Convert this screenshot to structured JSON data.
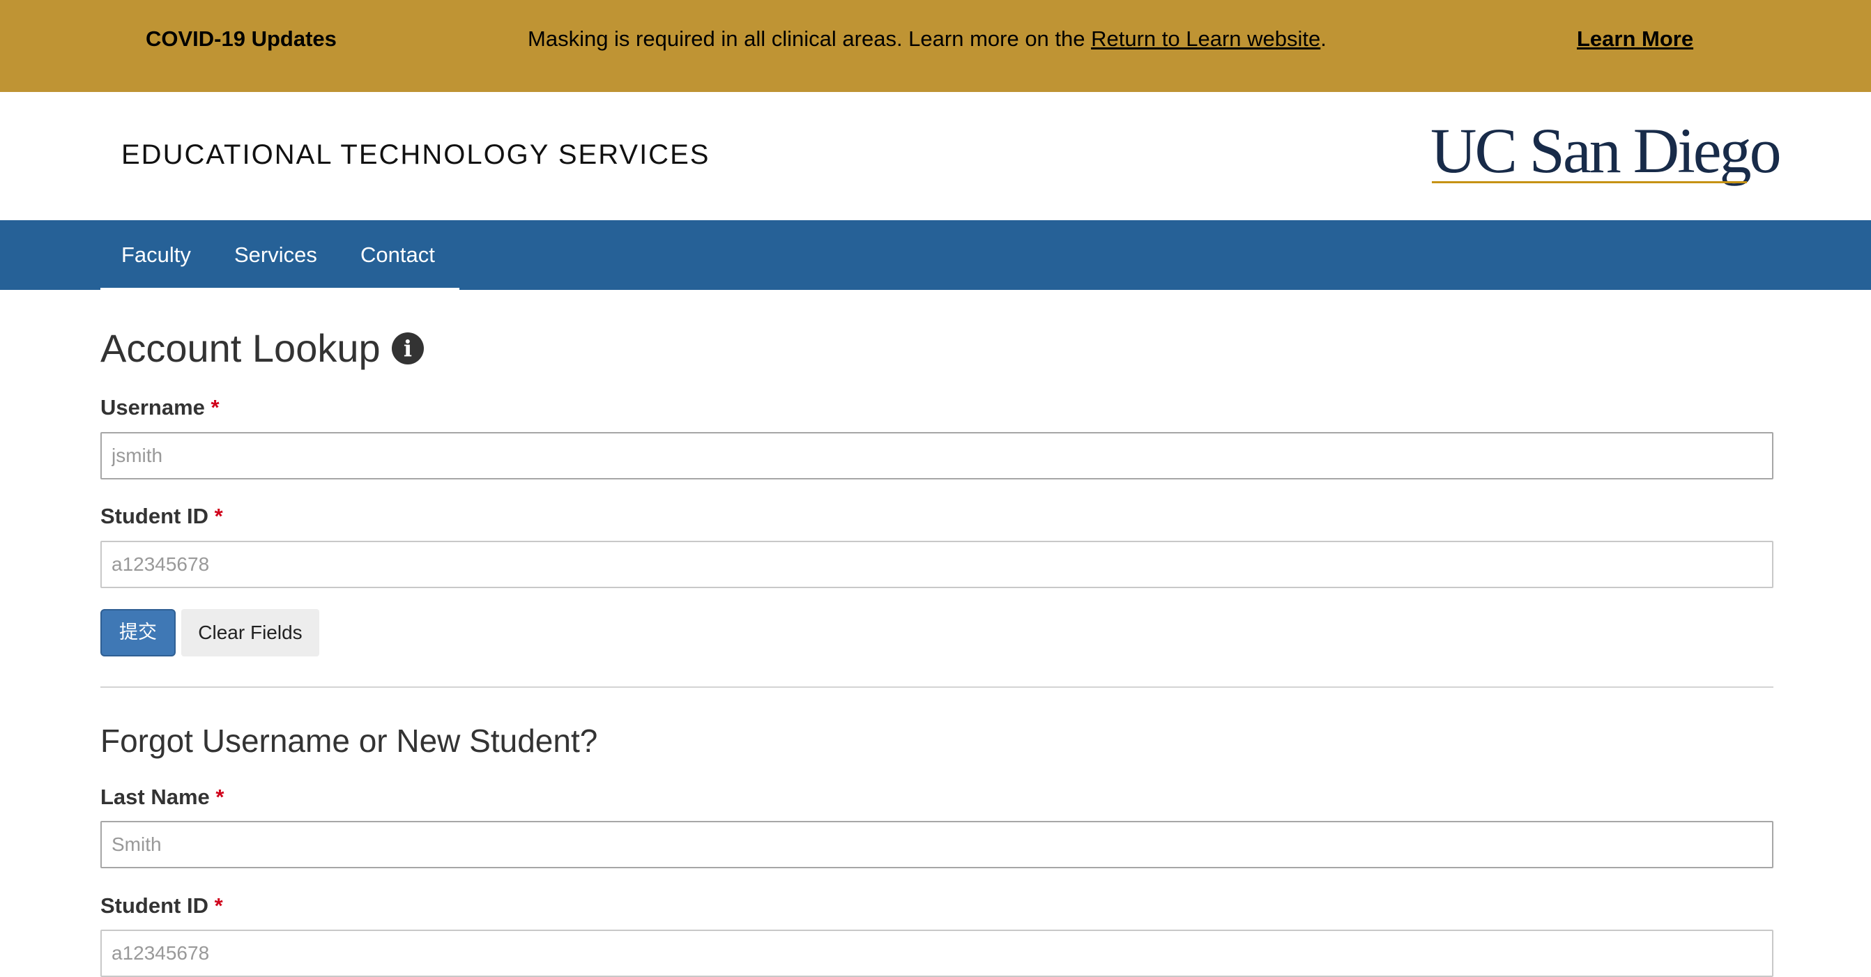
{
  "banner": {
    "title": "COVID-19 Updates",
    "message_prefix": "Masking is required in all clinical areas. Learn more on the ",
    "message_link": "Return to Learn website",
    "message_suffix": ".",
    "learn_more": "Learn More",
    "background_color": "#bf9434"
  },
  "header": {
    "site_title": "EDUCATIONAL TECHNOLOGY SERVICES",
    "logo_text": "UC San Diego"
  },
  "nav": {
    "background_color": "#266197",
    "items": [
      {
        "label": "Faculty"
      },
      {
        "label": "Services"
      },
      {
        "label": "Contact"
      }
    ]
  },
  "account_lookup": {
    "heading": "Account Lookup",
    "info_icon": "info-circle-icon",
    "username_label": "Username",
    "username_placeholder": "jsmith",
    "student_id_label": "Student ID",
    "student_id_placeholder": "a12345678",
    "required_mark": "*",
    "submit_label": "提交",
    "clear_label": "Clear Fields"
  },
  "forgot": {
    "heading": "Forgot Username or New Student?",
    "last_name_label": "Last Name",
    "last_name_placeholder": "Smith",
    "student_id_label": "Student ID",
    "student_id_placeholder": "a12345678",
    "required_mark": "*"
  }
}
